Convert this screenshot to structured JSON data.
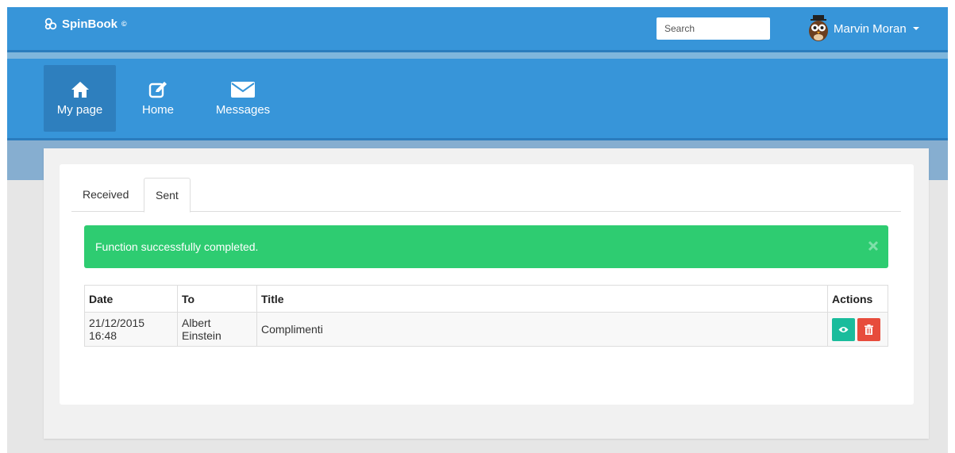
{
  "app": {
    "brand": "SpinBook",
    "brand_mark": "©"
  },
  "header": {
    "search_placeholder": "Search",
    "user_name": "Marvin Moran"
  },
  "nav": {
    "items": [
      {
        "label": "My page",
        "icon": "home-icon",
        "active": true
      },
      {
        "label": "Home",
        "icon": "edit-icon",
        "active": false
      },
      {
        "label": "Messages",
        "icon": "envelope-icon",
        "active": false
      }
    ]
  },
  "tabs": [
    {
      "label": "Received",
      "active": false
    },
    {
      "label": "Sent",
      "active": true
    }
  ],
  "alert": {
    "message": "Function successfully completed."
  },
  "table": {
    "headers": [
      "Date",
      "To",
      "Title",
      "Actions"
    ],
    "rows": [
      {
        "date": "21/12/2015 16:48",
        "to": "Albert Einstein",
        "title": "Complimenti"
      }
    ]
  },
  "colors": {
    "primary": "#3795d9",
    "success": "#2ecc71",
    "view_button": "#1abc9c",
    "delete_button": "#e74c3c"
  }
}
